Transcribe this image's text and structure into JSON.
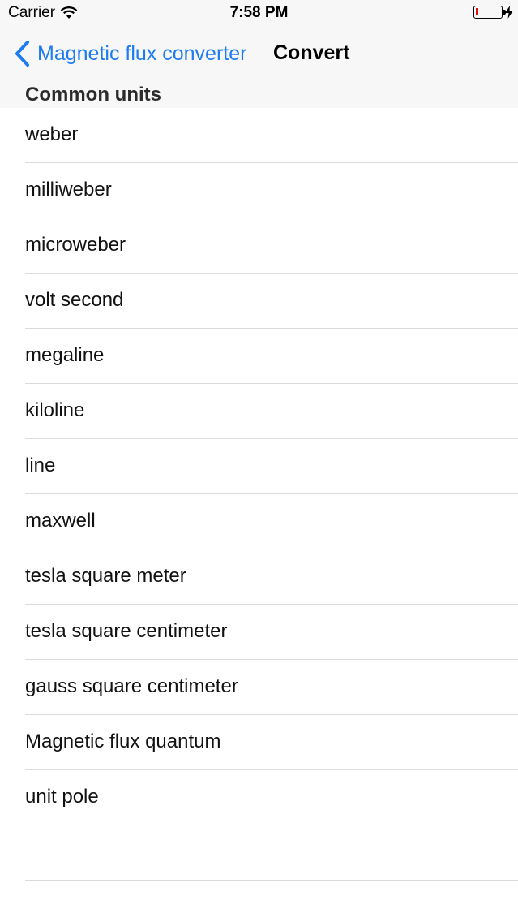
{
  "status_bar": {
    "carrier": "Carrier",
    "time": "7:58 PM",
    "wifi_icon": "wifi-icon",
    "battery_icon": "battery-low-icon",
    "charging_icon": "bolt-icon",
    "battery_color": "#e01010"
  },
  "nav": {
    "back_label": "Magnetic flux converter",
    "back_icon": "chevron-left-icon",
    "title": "Convert",
    "accent": "#1d7cf2"
  },
  "section": {
    "title": "Common units"
  },
  "units": [
    "weber",
    "milliweber",
    "microweber",
    "volt second",
    "megaline",
    "kiloline",
    "line",
    "maxwell",
    "tesla square meter",
    "tesla square centimeter",
    "gauss square centimeter",
    "Magnetic flux quantum",
    "unit pole"
  ]
}
